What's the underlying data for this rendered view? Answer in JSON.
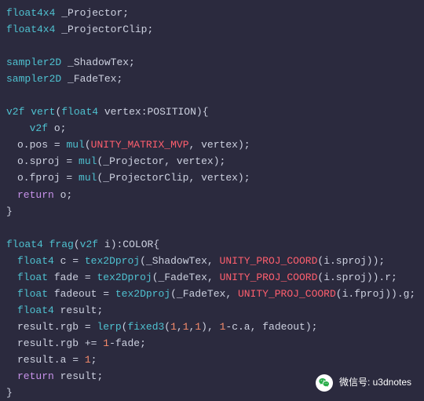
{
  "code": {
    "l1": {
      "type": "float4x4",
      "name": "_Projector"
    },
    "l2": {
      "type": "float4x4",
      "name": "_ProjectorClip"
    },
    "l3": {
      "type": "sampler2D",
      "name": "_ShadowTex"
    },
    "l4": {
      "type": "sampler2D",
      "name": "_FadeTex"
    },
    "vert": {
      "ret": "v2f",
      "name": "vert",
      "paramType": "float4",
      "paramName": "vertex",
      "semantic": "POSITION",
      "declType": "v2f",
      "declName": "o",
      "posLhs": "o.pos",
      "mul": "mul",
      "mvp": "UNITY_MATRIX_MVP",
      "vertex": "vertex",
      "sprojLhs": "o.sproj",
      "proj": "_Projector",
      "fprojLhs": "o.fproj",
      "projClip": "_ProjectorClip",
      "ret2": "return",
      "retVal": "o"
    },
    "frag": {
      "ret": "float4",
      "name": "frag",
      "paramType": "v2f",
      "paramName": "i",
      "semantic": "COLOR",
      "cType": "float4",
      "cName": "c",
      "tex2Dproj": "tex2Dproj",
      "shadowTex": "_ShadowTex",
      "upjc": "UNITY_PROJ_COORD",
      "isproj": "i.sproj",
      "fadeType": "float",
      "fadeName": "fade",
      "fadeTex": "_FadeTex",
      "dotR": ".r",
      "fadeoutType": "float",
      "fadeoutName": "fadeout",
      "ifproj": "i.fproj",
      "dotG": ".g",
      "resultType": "float4",
      "resultName": "result",
      "resultRgb": "result.rgb",
      "lerp": "lerp",
      "fixed3": "fixed3",
      "one": "1",
      "oneMinusCa": "-c.a",
      "fadeoutArg": "fadeout",
      "plusEq": "+=",
      "minusFade": "-fade",
      "resultA": "result.a",
      "ret2": "return",
      "retVal": "result"
    }
  },
  "footer": {
    "label": "微信号: u3dnotes"
  }
}
